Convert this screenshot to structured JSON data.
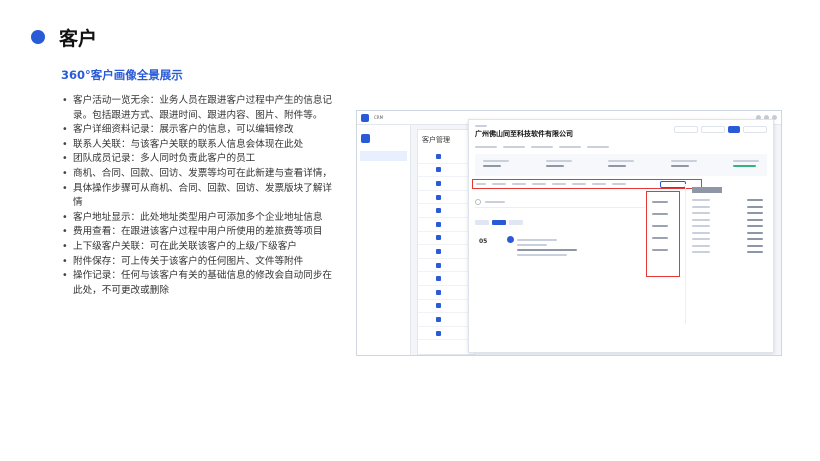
{
  "slide": {
    "title": "客户",
    "subtitle": "360°客户画像全景展示"
  },
  "bullets": [
    "客户活动一览无余：业务人员在跟进客户过程中产生的信息记录。包括跟进方式、跟进时间、跟进内容、图片、附件等。",
    "客户详细资料记录：展示客户的信息，可以编辑修改",
    "联系人关联：与该客户关联的联系人信息会体现在此处",
    "团队成员记录：多人同时负责此客户的员工",
    "商机、合同、回款、回访、发票等均可在此新建与查看详情，",
    "具体操作步骤可从商机、合同、回款、回访、发票版块了解详情",
    "客户地址显示：此处地址类型用户可添加多个企业地址信息",
    "费用查看：在跟进该客户过程中用户所使用的差旅费等项目",
    "上下级客户关联：可在此关联该客户的上级/下级客户",
    "附件保存：可上传关于该客户的任何图片、文件等附件",
    "操作记录：任何与该客户有关的基础信息的修改会自动同步在此处，不可更改或删除"
  ],
  "screenshot": {
    "app_name": "CRM",
    "list_title": "客户管理",
    "customer_name": "广州佛山同至科技软件有限公司",
    "activity_day": "05"
  }
}
